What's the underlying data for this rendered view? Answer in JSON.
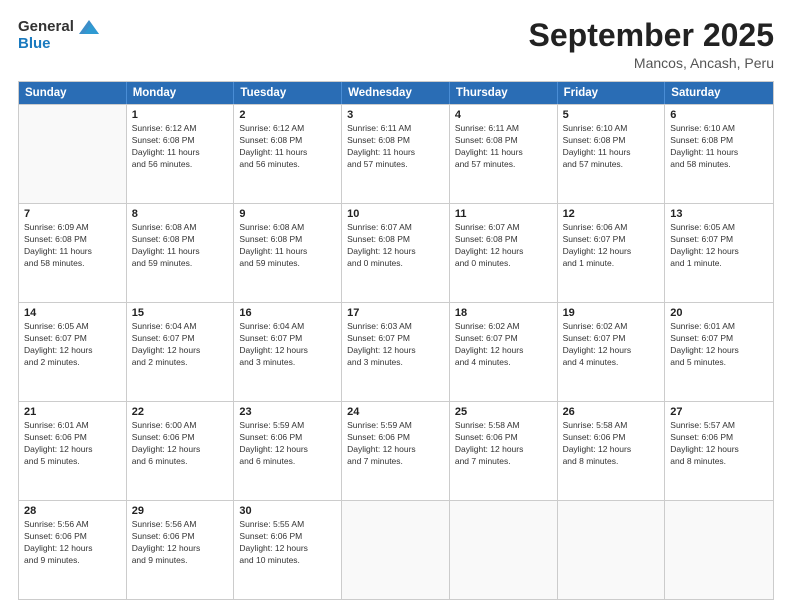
{
  "logo": {
    "line1": "General",
    "line2": "Blue"
  },
  "title": "September 2025",
  "location": "Mancos, Ancash, Peru",
  "days_of_week": [
    "Sunday",
    "Monday",
    "Tuesday",
    "Wednesday",
    "Thursday",
    "Friday",
    "Saturday"
  ],
  "weeks": [
    [
      {
        "day": "",
        "text": ""
      },
      {
        "day": "1",
        "text": "Sunrise: 6:12 AM\nSunset: 6:08 PM\nDaylight: 11 hours\nand 56 minutes."
      },
      {
        "day": "2",
        "text": "Sunrise: 6:12 AM\nSunset: 6:08 PM\nDaylight: 11 hours\nand 56 minutes."
      },
      {
        "day": "3",
        "text": "Sunrise: 6:11 AM\nSunset: 6:08 PM\nDaylight: 11 hours\nand 57 minutes."
      },
      {
        "day": "4",
        "text": "Sunrise: 6:11 AM\nSunset: 6:08 PM\nDaylight: 11 hours\nand 57 minutes."
      },
      {
        "day": "5",
        "text": "Sunrise: 6:10 AM\nSunset: 6:08 PM\nDaylight: 11 hours\nand 57 minutes."
      },
      {
        "day": "6",
        "text": "Sunrise: 6:10 AM\nSunset: 6:08 PM\nDaylight: 11 hours\nand 58 minutes."
      }
    ],
    [
      {
        "day": "7",
        "text": "Sunrise: 6:09 AM\nSunset: 6:08 PM\nDaylight: 11 hours\nand 58 minutes."
      },
      {
        "day": "8",
        "text": "Sunrise: 6:08 AM\nSunset: 6:08 PM\nDaylight: 11 hours\nand 59 minutes."
      },
      {
        "day": "9",
        "text": "Sunrise: 6:08 AM\nSunset: 6:08 PM\nDaylight: 11 hours\nand 59 minutes."
      },
      {
        "day": "10",
        "text": "Sunrise: 6:07 AM\nSunset: 6:08 PM\nDaylight: 12 hours\nand 0 minutes."
      },
      {
        "day": "11",
        "text": "Sunrise: 6:07 AM\nSunset: 6:08 PM\nDaylight: 12 hours\nand 0 minutes."
      },
      {
        "day": "12",
        "text": "Sunrise: 6:06 AM\nSunset: 6:07 PM\nDaylight: 12 hours\nand 1 minute."
      },
      {
        "day": "13",
        "text": "Sunrise: 6:05 AM\nSunset: 6:07 PM\nDaylight: 12 hours\nand 1 minute."
      }
    ],
    [
      {
        "day": "14",
        "text": "Sunrise: 6:05 AM\nSunset: 6:07 PM\nDaylight: 12 hours\nand 2 minutes."
      },
      {
        "day": "15",
        "text": "Sunrise: 6:04 AM\nSunset: 6:07 PM\nDaylight: 12 hours\nand 2 minutes."
      },
      {
        "day": "16",
        "text": "Sunrise: 6:04 AM\nSunset: 6:07 PM\nDaylight: 12 hours\nand 3 minutes."
      },
      {
        "day": "17",
        "text": "Sunrise: 6:03 AM\nSunset: 6:07 PM\nDaylight: 12 hours\nand 3 minutes."
      },
      {
        "day": "18",
        "text": "Sunrise: 6:02 AM\nSunset: 6:07 PM\nDaylight: 12 hours\nand 4 minutes."
      },
      {
        "day": "19",
        "text": "Sunrise: 6:02 AM\nSunset: 6:07 PM\nDaylight: 12 hours\nand 4 minutes."
      },
      {
        "day": "20",
        "text": "Sunrise: 6:01 AM\nSunset: 6:07 PM\nDaylight: 12 hours\nand 5 minutes."
      }
    ],
    [
      {
        "day": "21",
        "text": "Sunrise: 6:01 AM\nSunset: 6:06 PM\nDaylight: 12 hours\nand 5 minutes."
      },
      {
        "day": "22",
        "text": "Sunrise: 6:00 AM\nSunset: 6:06 PM\nDaylight: 12 hours\nand 6 minutes."
      },
      {
        "day": "23",
        "text": "Sunrise: 5:59 AM\nSunset: 6:06 PM\nDaylight: 12 hours\nand 6 minutes."
      },
      {
        "day": "24",
        "text": "Sunrise: 5:59 AM\nSunset: 6:06 PM\nDaylight: 12 hours\nand 7 minutes."
      },
      {
        "day": "25",
        "text": "Sunrise: 5:58 AM\nSunset: 6:06 PM\nDaylight: 12 hours\nand 7 minutes."
      },
      {
        "day": "26",
        "text": "Sunrise: 5:58 AM\nSunset: 6:06 PM\nDaylight: 12 hours\nand 8 minutes."
      },
      {
        "day": "27",
        "text": "Sunrise: 5:57 AM\nSunset: 6:06 PM\nDaylight: 12 hours\nand 8 minutes."
      }
    ],
    [
      {
        "day": "28",
        "text": "Sunrise: 5:56 AM\nSunset: 6:06 PM\nDaylight: 12 hours\nand 9 minutes."
      },
      {
        "day": "29",
        "text": "Sunrise: 5:56 AM\nSunset: 6:06 PM\nDaylight: 12 hours\nand 9 minutes."
      },
      {
        "day": "30",
        "text": "Sunrise: 5:55 AM\nSunset: 6:06 PM\nDaylight: 12 hours\nand 10 minutes."
      },
      {
        "day": "",
        "text": ""
      },
      {
        "day": "",
        "text": ""
      },
      {
        "day": "",
        "text": ""
      },
      {
        "day": "",
        "text": ""
      }
    ]
  ]
}
